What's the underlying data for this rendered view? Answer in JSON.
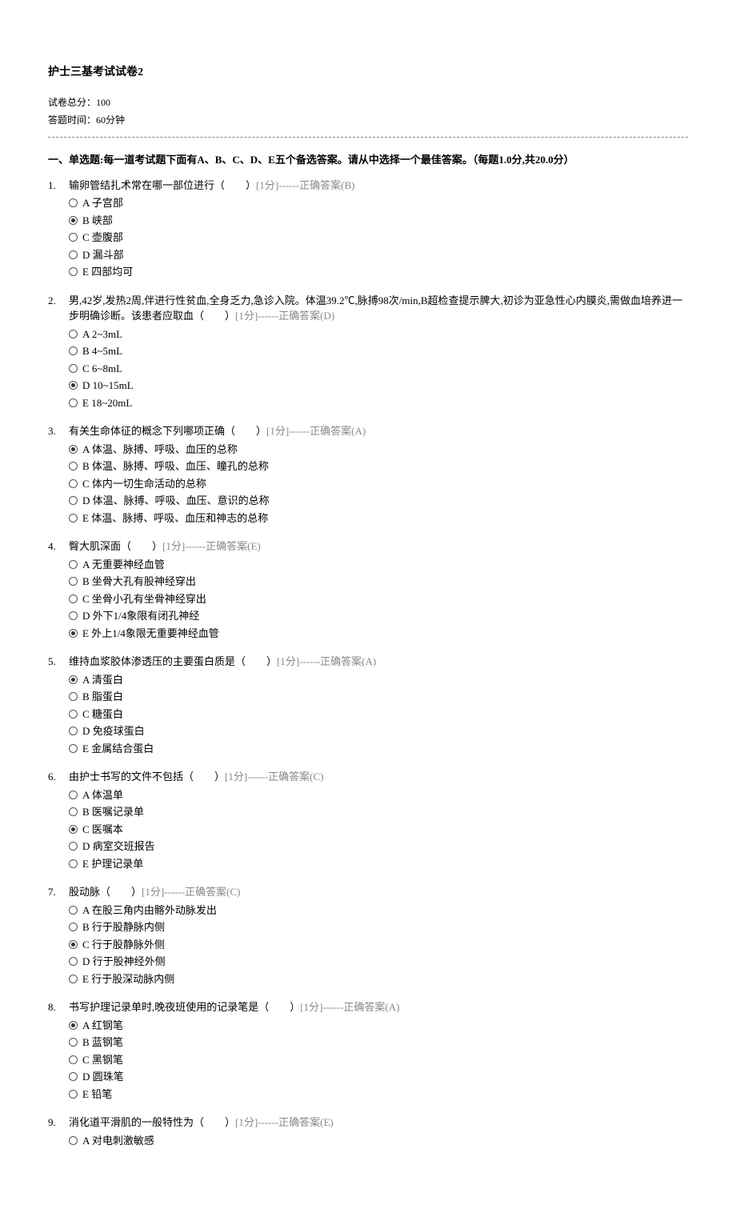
{
  "title": "护士三基考试试卷2",
  "meta": {
    "total_score": "试卷总分：100",
    "time_limit": "答题时间：60分钟"
  },
  "section_title": "一、单选题:每一道考试题下面有A、B、C、D、E五个备选答案。请从中选择一个最佳答案。（每题1.0分,共20.0分）",
  "points_label": "[1分]",
  "answer_prefix": "------正确答案",
  "questions": [
    {
      "num": "1.",
      "text": "输卵管结扎术常在哪一部位进行（　　）",
      "answer": "(B)",
      "correct": "B",
      "options": [
        {
          "letter": "A",
          "text": "子宫部"
        },
        {
          "letter": "B",
          "text": "峡部"
        },
        {
          "letter": "C",
          "text": "壶腹部"
        },
        {
          "letter": "D",
          "text": "漏斗部"
        },
        {
          "letter": "E",
          "text": "四部均可"
        }
      ]
    },
    {
      "num": "2.",
      "text": "男,42岁,发热2周,伴进行性贫血,全身乏力,急诊入院。体温39.2℃,脉搏98次/min,B超检查提示脾大,初诊为亚急性心内膜炎,需做血培养进一步明确诊断。该患者应取血（　　）",
      "answer": "(D)",
      "correct": "D",
      "options": [
        {
          "letter": "A",
          "text": "2~3mL"
        },
        {
          "letter": "B",
          "text": "4~5mL"
        },
        {
          "letter": "C",
          "text": "6~8mL"
        },
        {
          "letter": "D",
          "text": "10~15mL"
        },
        {
          "letter": "E",
          "text": "18~20mL"
        }
      ]
    },
    {
      "num": "3.",
      "text": "有关生命体征的概念下列哪项正确（　　）",
      "answer": "(A)",
      "correct": "A",
      "options": [
        {
          "letter": "A",
          "text": "体温、脉搏、呼吸、血压的总称"
        },
        {
          "letter": "B",
          "text": "体温、脉搏、呼吸、血压、瞳孔的总称"
        },
        {
          "letter": "C",
          "text": "体内一切生命活动的总称"
        },
        {
          "letter": "D",
          "text": "体温、脉搏、呼吸、血压、意识的总称"
        },
        {
          "letter": "E",
          "text": "体温、脉搏、呼吸、血压和神志的总称"
        }
      ]
    },
    {
      "num": "4.",
      "text": "臀大肌深面（　　）",
      "answer": "(E)",
      "correct": "E",
      "options": [
        {
          "letter": "A",
          "text": "无重要神经血管"
        },
        {
          "letter": "B",
          "text": "坐骨大孔有股神经穿出"
        },
        {
          "letter": "C",
          "text": "坐骨小孔有坐骨神经穿出"
        },
        {
          "letter": "D",
          "text": "外下1/4象限有闭孔神经"
        },
        {
          "letter": "E",
          "text": "外上1/4象限无重要神经血管"
        }
      ]
    },
    {
      "num": "5.",
      "text": "维持血浆胶体渗透压的主要蛋白质是（　　）",
      "answer": "(A)",
      "correct": "A",
      "options": [
        {
          "letter": "A",
          "text": "清蛋白"
        },
        {
          "letter": "B",
          "text": "脂蛋白"
        },
        {
          "letter": "C",
          "text": "糖蛋白"
        },
        {
          "letter": "D",
          "text": "免疫球蛋白"
        },
        {
          "letter": "E",
          "text": "金属结合蛋白"
        }
      ]
    },
    {
      "num": "6.",
      "text": "由护士书写的文件不包括（　　）",
      "answer": "(C)",
      "correct": "C",
      "options": [
        {
          "letter": "A",
          "text": "体温单"
        },
        {
          "letter": "B",
          "text": "医嘱记录单"
        },
        {
          "letter": "C",
          "text": "医嘱本"
        },
        {
          "letter": "D",
          "text": "病室交班报告"
        },
        {
          "letter": "E",
          "text": "护理记录单"
        }
      ]
    },
    {
      "num": "7.",
      "text": "股动脉（　　）",
      "answer": "(C)",
      "correct": "C",
      "options": [
        {
          "letter": "A",
          "text": "在股三角内由髂外动脉发出"
        },
        {
          "letter": "B",
          "text": "行于股静脉内侧"
        },
        {
          "letter": "C",
          "text": "行于股静脉外侧"
        },
        {
          "letter": "D",
          "text": "行于股神经外侧"
        },
        {
          "letter": "E",
          "text": "行于股深动脉内侧"
        }
      ]
    },
    {
      "num": "8.",
      "text": "书写护理记录单时,晚夜班使用的记录笔是（　　）",
      "answer": "(A)",
      "correct": "A",
      "options": [
        {
          "letter": "A",
          "text": "红钢笔"
        },
        {
          "letter": "B",
          "text": "蓝钢笔"
        },
        {
          "letter": "C",
          "text": "黑钢笔"
        },
        {
          "letter": "D",
          "text": "圆珠笔"
        },
        {
          "letter": "E",
          "text": "铅笔"
        }
      ]
    },
    {
      "num": "9.",
      "text": "消化道平滑肌的一般特性为（　　）",
      "answer": "(E)",
      "correct": "E",
      "options": [
        {
          "letter": "A",
          "text": "对电刺激敏感"
        }
      ]
    }
  ]
}
